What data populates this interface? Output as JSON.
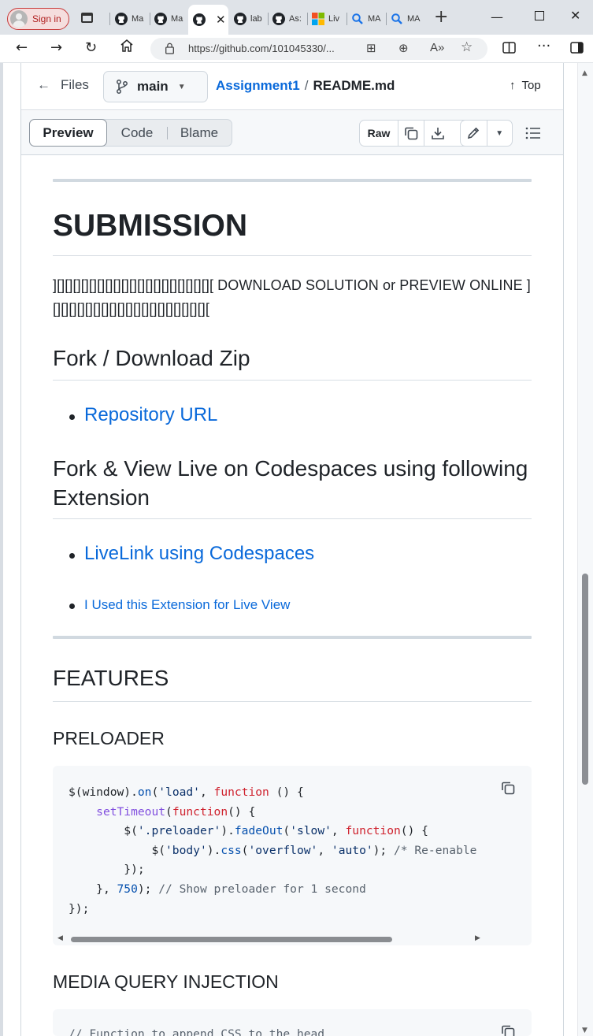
{
  "browser": {
    "signin_label": "Sign in",
    "tabs": [
      {
        "label": "Ma",
        "icon": "github-icon"
      },
      {
        "label": "Ma",
        "icon": "github-icon"
      },
      {
        "label": "",
        "icon": "github-icon",
        "active": true
      },
      {
        "label": "lab",
        "icon": "github-icon"
      },
      {
        "label": "As:",
        "icon": "github-icon"
      },
      {
        "label": "Liv",
        "icon": "microsoft-icon"
      },
      {
        "label": "MA",
        "icon": "search-icon"
      },
      {
        "label": "MA",
        "icon": "search-icon"
      }
    ],
    "url": "https://github.com/101045330/..."
  },
  "file_header": {
    "files_label": "Files",
    "branch": "main",
    "repo": "Assignment1",
    "separator": "/",
    "filename": "README.md",
    "top_label": "Top"
  },
  "toolbar": {
    "preview": "Preview",
    "code": "Code",
    "blame": "Blame",
    "raw": "Raw"
  },
  "content": {
    "submission_heading": "SUBMISSION",
    "submission_text": "][][][][][][][][][][][][][][][][][][][][ DOWNLOAD SOLUTION or PREVIEW ONLINE ][][][][][][][][][][][][][][][][][][][][",
    "fork_heading": "Fork / Download Zip",
    "repo_link": "Repository URL",
    "codespaces_heading": "Fork & View Live on Codespaces using following Extension",
    "livelink": "LiveLink using Codespaces",
    "extension_link": "I Used this Extension for Live View",
    "features_heading": "FEATURES",
    "preloader_heading": "PRELOADER",
    "media_heading": "MEDIA QUERY INJECTION",
    "next_code_line": "// Function to append CSS to the head"
  },
  "code": {
    "l1_a": "$(window).",
    "l1_fn": "on",
    "l1_b": "(",
    "l1_s": "'load'",
    "l1_c": ", ",
    "l1_k": "function",
    "l1_d": " () {",
    "l2_fn": "setTimeout",
    "l2_b": "(",
    "l2_k": "function",
    "l2_c": "() {",
    "l3_a": "$(",
    "l3_s1": "'.preloader'",
    "l3_b": ").",
    "l3_fn": "fadeOut",
    "l3_c": "(",
    "l3_s2": "'slow'",
    "l3_d": ", ",
    "l3_k": "function",
    "l3_e": "() {",
    "l4_a": "$(",
    "l4_s1": "'body'",
    "l4_b": ").",
    "l4_fn": "css",
    "l4_c": "(",
    "l4_s2": "'overflow'",
    "l4_d": ", ",
    "l4_s3": "'auto'",
    "l4_e": "); ",
    "l4_cm": "/* Re-enable",
    "l5": "});",
    "l6_a": "}, ",
    "l6_n": "750",
    "l6_b": "); ",
    "l6_cm": "// Show preloader for 1 second",
    "l7": "});"
  }
}
